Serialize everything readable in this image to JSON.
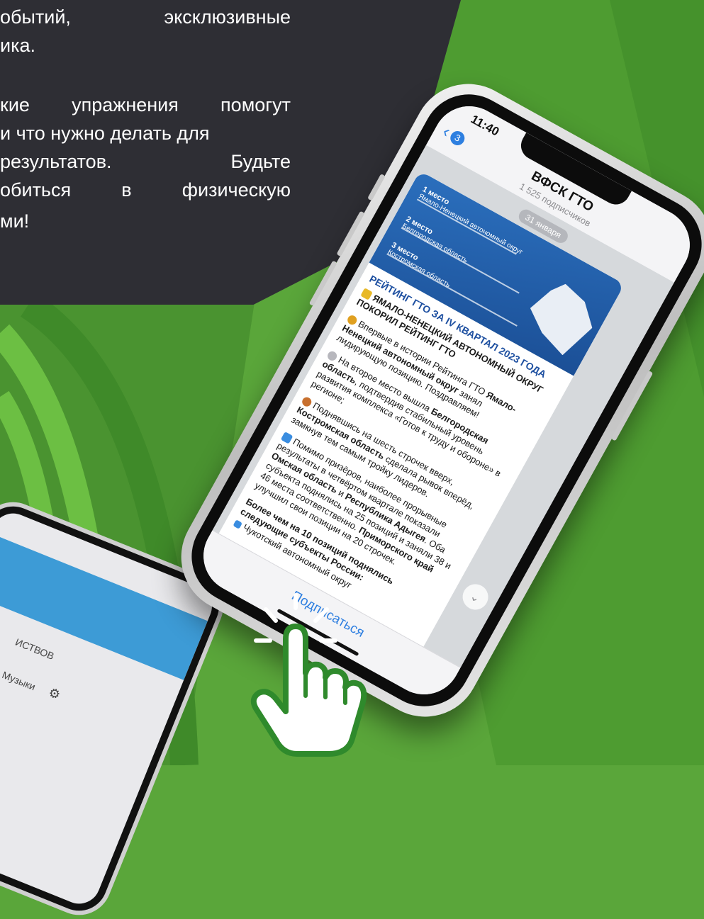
{
  "promo": {
    "lines": [
      "обытий,  эксклюзивные",
      "ика.",
      "кие упражнения помогут",
      "и что нужно делать для",
      "результатов.   Будьте",
      "обиться  в  физическую",
      "ми!"
    ]
  },
  "phone": {
    "status_time": "11:40",
    "back_badge": "3",
    "channel_title": "ВФСК ГТО",
    "channel_subscribers": "1 525 подписчиков",
    "date_label": "31 января",
    "image": {
      "places": [
        {
          "rank": "1 место",
          "region": "Ямало-Ненецкий автономный округ"
        },
        {
          "rank": "2 место",
          "region": "Белгородская область"
        },
        {
          "rank": "3 место",
          "region": "Костромская область"
        }
      ]
    },
    "message": {
      "headline": "РЕЙТИНГ ГТО ЗА IV КВАРТАЛ 2023 ГОДА",
      "p1": "ЯМАЛО-НЕНЕЦКИЙ АВТОНОМНЫЙ ОКРУГ ПОКОРИЛ РЕЙТИНГ ГТО",
      "p2_a": "Впервые в истории Рейтинга ГТО ",
      "p2_b": "Ямало-Ненецкий автономный округ",
      "p2_c": " занял лидирующую позицию. Поздравляем!",
      "p3_a": "На второе место вышла ",
      "p3_b": "Белгородская область",
      "p3_c": ", подтвердив стабильный уровень развития комплекса «Готов к труду и обороне» в регионе;",
      "p4_a": "Поднявшись на шесть строчек вверх, ",
      "p4_b": "Костромская область",
      "p4_c": " сделала рывок вперёд, замкнув тем самым тройку лидеров.",
      "p5_a": "Помимо призёров, наиболее прорывные результаты в четвёртом квартале показали ",
      "p5_b": "Омская область",
      "p5_c": " и ",
      "p5_d": "Республика Адыгея",
      "p5_e": ". Оба субъекта поднялись на 25 позиций и заняли 38 и 46 места соответственно. ",
      "p5_f": "Приморского край",
      "p5_g": " улучшил свои позиции на 20 строчек.",
      "p6": "Более чем на 10 позиций поднялись следующие субъекты России:",
      "p7": "Чукотский автономный округ"
    },
    "subscribe_label": "Подписаться"
  },
  "phone2": {
    "row1": "ИСТВОВ",
    "row2": "Музыки"
  },
  "colors": {
    "bg_green": "#5aa63a",
    "dark_panel": "#2e2e34",
    "link_blue": "#2e7fe0",
    "headline_blue": "#1d4fa0"
  }
}
